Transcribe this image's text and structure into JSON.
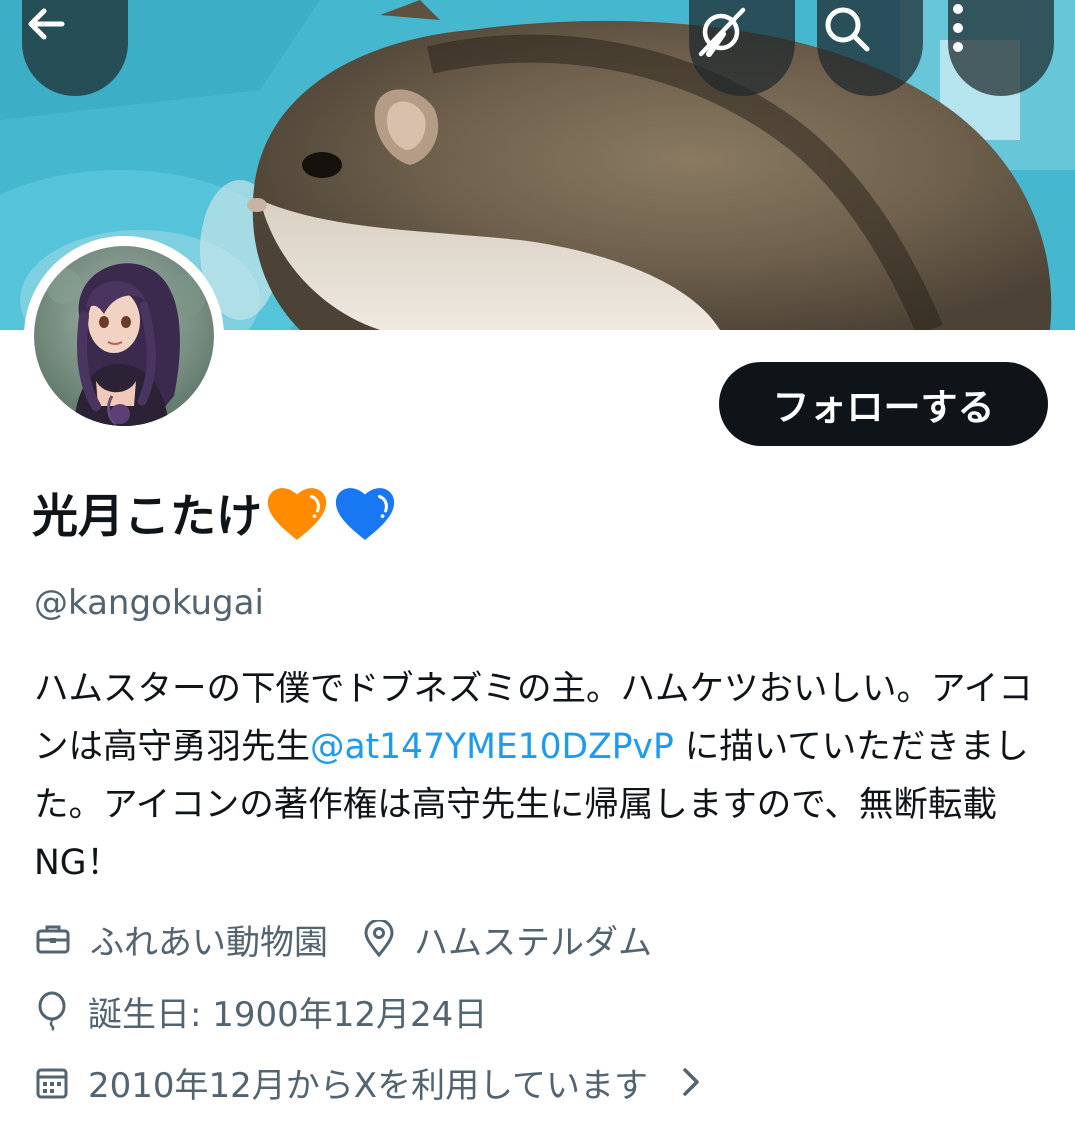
{
  "toolbar": {
    "back_icon": "arrow-left-icon",
    "translate_icon": "translate-off-icon",
    "search_icon": "search-icon",
    "more_icon": "more-vertical-icon"
  },
  "profile": {
    "follow_label": "フォローする",
    "display_name": "光月こたけ",
    "hearts": [
      {
        "icon": "orange-heart-icon",
        "color": "#ff8c00"
      },
      {
        "icon": "blue-heart-icon",
        "color": "#1877f2"
      }
    ],
    "handle": "@kangokugai",
    "bio_before": "ハムスターの下僕でドブネズミの主。ハムケツおいしい。アイコンは高守勇羽先生",
    "bio_mention": "@at147YME10DZPvP",
    "bio_after": " に描いていただきました。アイコンの著作権は高守先生に帰属しますので、無断転載NG！",
    "category": "ふれあい動物園",
    "location": "ハムステルダム",
    "birthday": "誕生日: 1900年12月24日",
    "joined": "2010年12月からXを利用しています"
  },
  "colors": {
    "text_primary": "#0f1419",
    "text_secondary": "#536471",
    "link": "#1d9bf0",
    "button_bg": "#0f1419"
  }
}
